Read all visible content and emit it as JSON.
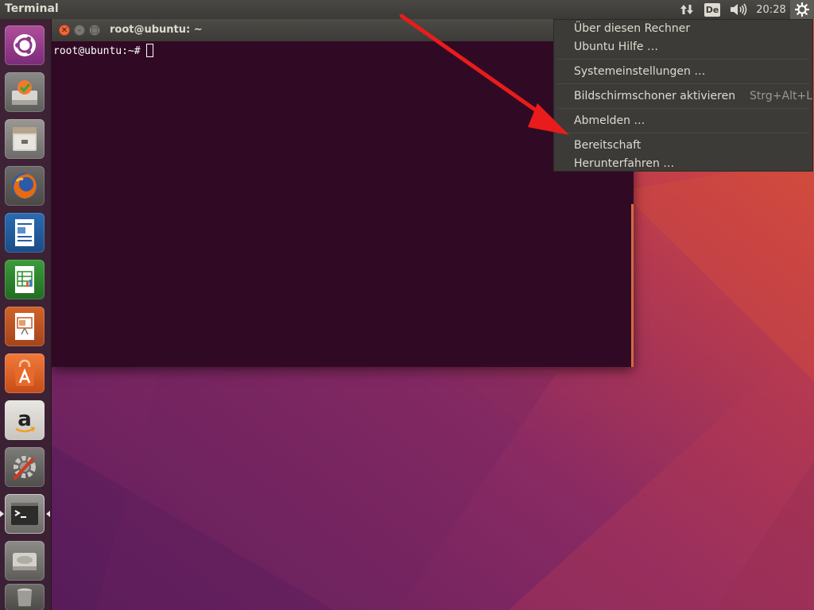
{
  "top_panel": {
    "active_app": "Terminal",
    "language_indicator": "De",
    "clock": "20:28",
    "icons": {
      "network": "network-transfer-icon",
      "volume": "volume-icon",
      "session": "gear-session-icon"
    }
  },
  "launcher": {
    "items": [
      {
        "icon": "dash-home-icon"
      },
      {
        "icon": "software-updater-icon"
      },
      {
        "icon": "files-icon"
      },
      {
        "icon": "firefox-icon"
      },
      {
        "icon": "libreoffice-writer-icon"
      },
      {
        "icon": "libreoffice-calc-icon"
      },
      {
        "icon": "libreoffice-impress-icon"
      },
      {
        "icon": "ubuntu-software-icon"
      },
      {
        "icon": "amazon-icon"
      },
      {
        "icon": "system-settings-icon"
      },
      {
        "icon": "terminal-icon",
        "active": true
      },
      {
        "icon": "disk-icon"
      },
      {
        "icon": "trash-icon"
      }
    ]
  },
  "terminal": {
    "title": "root@ubuntu: ~",
    "prompt": "root@ubuntu:~#",
    "background": "#300a24"
  },
  "session_menu": {
    "items": [
      {
        "label": "Über diesen Rechner"
      },
      {
        "label": "Ubuntu Hilfe …"
      },
      {
        "label": "Systemeinstellungen …"
      },
      {
        "label": "Bildschirmschoner aktivieren",
        "shortcut": "Strg+Alt+L"
      },
      {
        "label": "Abmelden …"
      },
      {
        "label": "Bereitschaft"
      },
      {
        "label": "Herunterfahren …"
      }
    ]
  },
  "colors": {
    "panel": "#3c3b37",
    "terminal_bg": "#300a24",
    "accent_orange": "#e95420",
    "arrow": "#e81c1c"
  }
}
